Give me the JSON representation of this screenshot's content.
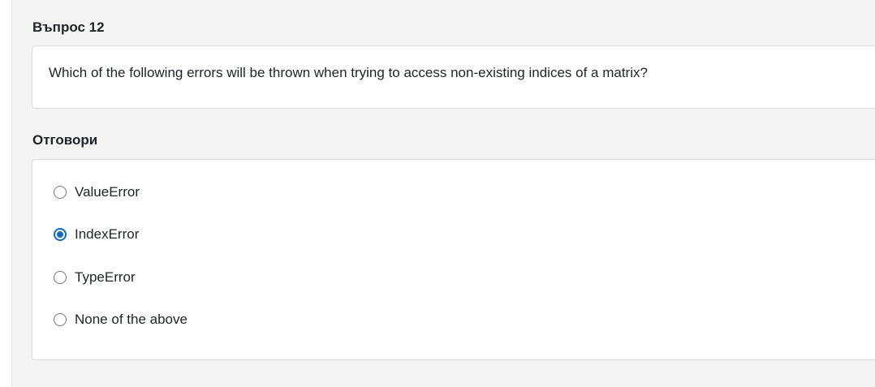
{
  "question": {
    "heading": "Въпрос 12",
    "text": "Which of the following errors will be thrown when trying to access non-existing indices of a matrix?"
  },
  "answers": {
    "heading": "Отговори",
    "options": [
      {
        "label": "ValueError",
        "selected": false
      },
      {
        "label": "IndexError",
        "selected": true
      },
      {
        "label": "TypeError",
        "selected": false
      },
      {
        "label": "None of the above",
        "selected": false
      }
    ]
  },
  "colors": {
    "accent": "#0f6cbf",
    "background": "#f4f4f4",
    "card": "#ffffff"
  }
}
